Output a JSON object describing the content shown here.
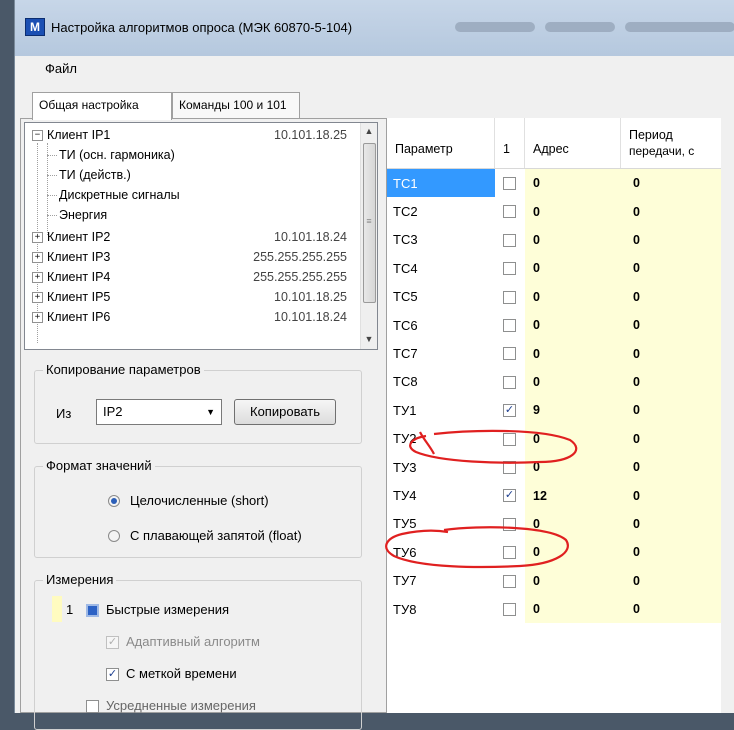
{
  "window": {
    "title": "Настройка алгоритмов опроса (МЭК 60870-5-104)",
    "icon_text": "М"
  },
  "menu": {
    "file": "Файл"
  },
  "tabs": [
    {
      "label": "Общая настройка",
      "active": true
    },
    {
      "label": "Команды 100 и 101",
      "active": false
    }
  ],
  "tree": {
    "root": {
      "label": "Клиент IP1",
      "ip": "10.101.18.25",
      "expanded": true,
      "children": [
        "ТИ (осн. гармоника)",
        "ТИ (действ.)",
        "Дискретные сигналы",
        "Энергия"
      ]
    },
    "clients": [
      {
        "label": "Клиент IP2",
        "ip": "10.101.18.24"
      },
      {
        "label": "Клиент IP3",
        "ip": "255.255.255.255"
      },
      {
        "label": "Клиент IP4",
        "ip": "255.255.255.255"
      },
      {
        "label": "Клиент IP5",
        "ip": "10.101.18.25"
      },
      {
        "label": "Клиент IP6",
        "ip": "10.101.18.24"
      }
    ]
  },
  "copy_group": {
    "title": "Копирование параметров",
    "from_label": "Из",
    "from_value": "IP2",
    "copy_button": "Копировать"
  },
  "format_group": {
    "title": "Формат значений",
    "options": [
      {
        "label": "Целочисленные (short)",
        "selected": true
      },
      {
        "label": "С плавающей запятой (float)",
        "selected": false
      }
    ]
  },
  "measure_group": {
    "title": "Измерения",
    "index": "1",
    "fast": "Быстрые измерения",
    "adaptive": "Адаптивный алгоритм",
    "timestamp": "С меткой времени",
    "averaged": "Усредненные измерения"
  },
  "grid": {
    "headers": {
      "param": "Параметр",
      "col1": "1",
      "addr": "Адрес",
      "period_1": "Период",
      "period_2": "передачи, с"
    },
    "rows": [
      {
        "param": "ТС1",
        "checked": false,
        "addr": "0",
        "period": "0",
        "selected": true
      },
      {
        "param": "ТС2",
        "checked": false,
        "addr": "0",
        "period": "0"
      },
      {
        "param": "ТС3",
        "checked": false,
        "addr": "0",
        "period": "0"
      },
      {
        "param": "ТС4",
        "checked": false,
        "addr": "0",
        "period": "0"
      },
      {
        "param": "ТС5",
        "checked": false,
        "addr": "0",
        "period": "0"
      },
      {
        "param": "ТС6",
        "checked": false,
        "addr": "0",
        "period": "0"
      },
      {
        "param": "ТС7",
        "checked": false,
        "addr": "0",
        "period": "0"
      },
      {
        "param": "ТС8",
        "checked": false,
        "addr": "0",
        "period": "0"
      },
      {
        "param": "ТУ1",
        "checked": true,
        "addr": "9",
        "period": "0"
      },
      {
        "param": "ТУ2",
        "checked": false,
        "addr": "0",
        "period": "0"
      },
      {
        "param": "ТУ3",
        "checked": false,
        "addr": "0",
        "period": "0"
      },
      {
        "param": "ТУ4",
        "checked": true,
        "addr": "12",
        "period": "0"
      },
      {
        "param": "ТУ5",
        "checked": false,
        "addr": "0",
        "period": "0"
      },
      {
        "param": "ТУ6",
        "checked": false,
        "addr": "0",
        "period": "0"
      },
      {
        "param": "ТУ7",
        "checked": false,
        "addr": "0",
        "period": "0"
      },
      {
        "param": "ТУ8",
        "checked": false,
        "addr": "0",
        "period": "0"
      }
    ]
  },
  "colors": {
    "selection": "#3399ff",
    "editable_cell": "#fefed8",
    "annotation": "#e02020"
  }
}
